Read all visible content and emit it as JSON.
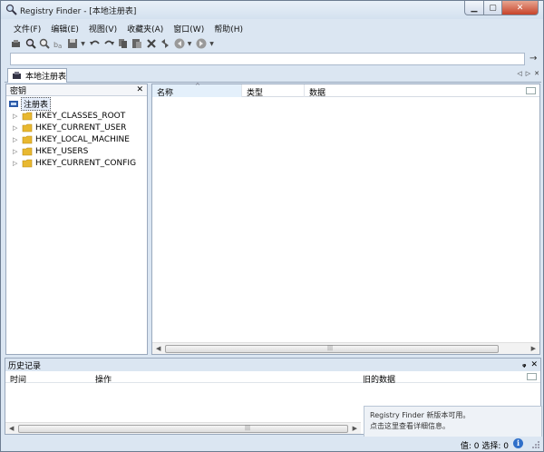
{
  "window": {
    "title": "Registry Finder - [本地注册表]"
  },
  "menu": [
    "文件(F)",
    "编辑(E)",
    "视图(V)",
    "收藏夹(A)",
    "窗口(W)",
    "帮助(H)"
  ],
  "toolbar_icons": [
    "connect-icon",
    "find-icon",
    "find-next-icon",
    "replace-icon",
    "save-icon",
    "undo-icon",
    "redo-icon",
    "copy-icon",
    "paste-icon",
    "delete-icon",
    "refresh-icon",
    "back-icon",
    "forward-icon"
  ],
  "address": {
    "value": ""
  },
  "tab": {
    "label": "本地注册表"
  },
  "left_pane": {
    "title": "密钥",
    "root_label": "注册表",
    "keys": [
      "HKEY_CLASSES_ROOT",
      "HKEY_CURRENT_USER",
      "HKEY_LOCAL_MACHINE",
      "HKEY_USERS",
      "HKEY_CURRENT_CONFIG"
    ]
  },
  "right_pane": {
    "columns": [
      "名称",
      "类型",
      "数据"
    ]
  },
  "history": {
    "title": "历史记录",
    "columns": [
      "时间",
      "操作",
      "旧的数据"
    ],
    "notify_line1": "Registry Finder 新版本可用。",
    "notify_line2": "点击这里查看详细信息。"
  },
  "status": {
    "text": "值: 0  选择: 0",
    "info_icon": "i"
  },
  "colors": {
    "chrome": "#dbe6f2",
    "border": "#9aa9bd",
    "folder": "#e8b830",
    "close": "#c7432a"
  }
}
